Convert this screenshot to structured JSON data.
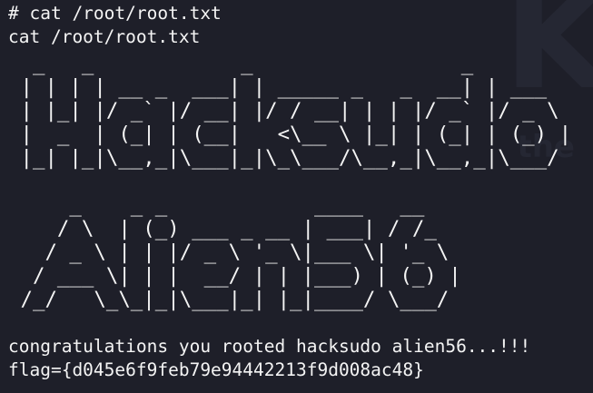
{
  "watermark": "K",
  "watermark_sub": "the",
  "terminal": {
    "prompt_line": "# cat /root/root.txt",
    "echo_line": "cat /root/root.txt",
    "banner_hacksudo": "  _   _            _                 _\n | | | | __ _  ___| | _____ _   _  __| | ___\n | |_| |/ _` |/ __| |/ / __| | | |/ _` |/ _ \\\n |  _  | (_| | (__|   <\\__ \\ |_| | (_| | (_) |\n |_| |_|\\__,_|\\___|_|\\_\\___/\\__,_|\\__,_|\\___/",
    "banner_alien": "     _    _ _            ____   __\n    / \\  | (_) ___ _ __ | ___| / /_\n   / _ \\ | | |/ _ \\ '_ \\|___ \\| '_ \\\n  / ___ \\| | |  __/ | | |___) | (_) |\n /_/   \\_\\_|_|\\___|_| |_|____/ \\___/",
    "congrats": "congratulations you rooted hacksudo alien56...!!!",
    "flag": "flag={d045e6f9feb79e94442213f9d008ac48}"
  }
}
